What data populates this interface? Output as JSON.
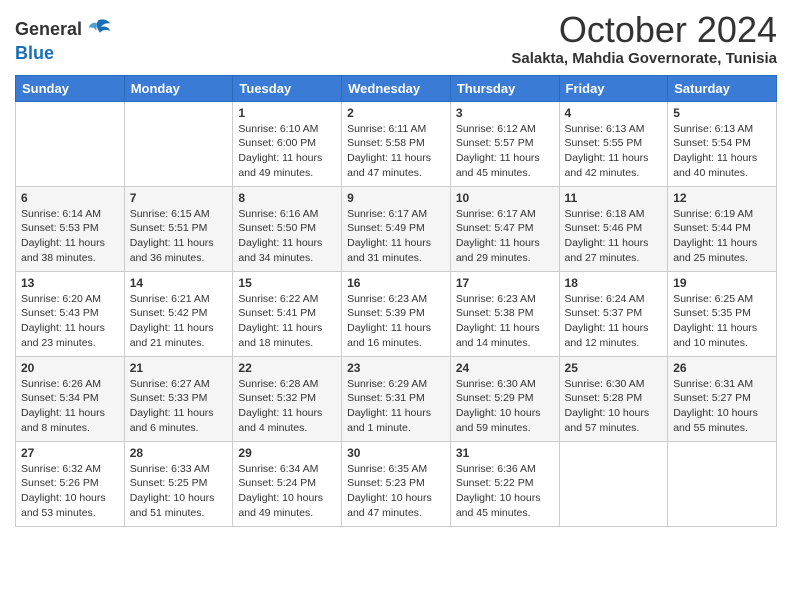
{
  "header": {
    "logo_general": "General",
    "logo_blue": "Blue",
    "month_title": "October 2024",
    "subtitle": "Salakta, Mahdia Governorate, Tunisia"
  },
  "days_of_week": [
    "Sunday",
    "Monday",
    "Tuesday",
    "Wednesday",
    "Thursday",
    "Friday",
    "Saturday"
  ],
  "weeks": [
    [
      {
        "day": "",
        "sunrise": "",
        "sunset": "",
        "daylight": ""
      },
      {
        "day": "",
        "sunrise": "",
        "sunset": "",
        "daylight": ""
      },
      {
        "day": "1",
        "sunrise": "Sunrise: 6:10 AM",
        "sunset": "Sunset: 6:00 PM",
        "daylight": "Daylight: 11 hours and 49 minutes."
      },
      {
        "day": "2",
        "sunrise": "Sunrise: 6:11 AM",
        "sunset": "Sunset: 5:58 PM",
        "daylight": "Daylight: 11 hours and 47 minutes."
      },
      {
        "day": "3",
        "sunrise": "Sunrise: 6:12 AM",
        "sunset": "Sunset: 5:57 PM",
        "daylight": "Daylight: 11 hours and 45 minutes."
      },
      {
        "day": "4",
        "sunrise": "Sunrise: 6:13 AM",
        "sunset": "Sunset: 5:55 PM",
        "daylight": "Daylight: 11 hours and 42 minutes."
      },
      {
        "day": "5",
        "sunrise": "Sunrise: 6:13 AM",
        "sunset": "Sunset: 5:54 PM",
        "daylight": "Daylight: 11 hours and 40 minutes."
      }
    ],
    [
      {
        "day": "6",
        "sunrise": "Sunrise: 6:14 AM",
        "sunset": "Sunset: 5:53 PM",
        "daylight": "Daylight: 11 hours and 38 minutes."
      },
      {
        "day": "7",
        "sunrise": "Sunrise: 6:15 AM",
        "sunset": "Sunset: 5:51 PM",
        "daylight": "Daylight: 11 hours and 36 minutes."
      },
      {
        "day": "8",
        "sunrise": "Sunrise: 6:16 AM",
        "sunset": "Sunset: 5:50 PM",
        "daylight": "Daylight: 11 hours and 34 minutes."
      },
      {
        "day": "9",
        "sunrise": "Sunrise: 6:17 AM",
        "sunset": "Sunset: 5:49 PM",
        "daylight": "Daylight: 11 hours and 31 minutes."
      },
      {
        "day": "10",
        "sunrise": "Sunrise: 6:17 AM",
        "sunset": "Sunset: 5:47 PM",
        "daylight": "Daylight: 11 hours and 29 minutes."
      },
      {
        "day": "11",
        "sunrise": "Sunrise: 6:18 AM",
        "sunset": "Sunset: 5:46 PM",
        "daylight": "Daylight: 11 hours and 27 minutes."
      },
      {
        "day": "12",
        "sunrise": "Sunrise: 6:19 AM",
        "sunset": "Sunset: 5:44 PM",
        "daylight": "Daylight: 11 hours and 25 minutes."
      }
    ],
    [
      {
        "day": "13",
        "sunrise": "Sunrise: 6:20 AM",
        "sunset": "Sunset: 5:43 PM",
        "daylight": "Daylight: 11 hours and 23 minutes."
      },
      {
        "day": "14",
        "sunrise": "Sunrise: 6:21 AM",
        "sunset": "Sunset: 5:42 PM",
        "daylight": "Daylight: 11 hours and 21 minutes."
      },
      {
        "day": "15",
        "sunrise": "Sunrise: 6:22 AM",
        "sunset": "Sunset: 5:41 PM",
        "daylight": "Daylight: 11 hours and 18 minutes."
      },
      {
        "day": "16",
        "sunrise": "Sunrise: 6:23 AM",
        "sunset": "Sunset: 5:39 PM",
        "daylight": "Daylight: 11 hours and 16 minutes."
      },
      {
        "day": "17",
        "sunrise": "Sunrise: 6:23 AM",
        "sunset": "Sunset: 5:38 PM",
        "daylight": "Daylight: 11 hours and 14 minutes."
      },
      {
        "day": "18",
        "sunrise": "Sunrise: 6:24 AM",
        "sunset": "Sunset: 5:37 PM",
        "daylight": "Daylight: 11 hours and 12 minutes."
      },
      {
        "day": "19",
        "sunrise": "Sunrise: 6:25 AM",
        "sunset": "Sunset: 5:35 PM",
        "daylight": "Daylight: 11 hours and 10 minutes."
      }
    ],
    [
      {
        "day": "20",
        "sunrise": "Sunrise: 6:26 AM",
        "sunset": "Sunset: 5:34 PM",
        "daylight": "Daylight: 11 hours and 8 minutes."
      },
      {
        "day": "21",
        "sunrise": "Sunrise: 6:27 AM",
        "sunset": "Sunset: 5:33 PM",
        "daylight": "Daylight: 11 hours and 6 minutes."
      },
      {
        "day": "22",
        "sunrise": "Sunrise: 6:28 AM",
        "sunset": "Sunset: 5:32 PM",
        "daylight": "Daylight: 11 hours and 4 minutes."
      },
      {
        "day": "23",
        "sunrise": "Sunrise: 6:29 AM",
        "sunset": "Sunset: 5:31 PM",
        "daylight": "Daylight: 11 hours and 1 minute."
      },
      {
        "day": "24",
        "sunrise": "Sunrise: 6:30 AM",
        "sunset": "Sunset: 5:29 PM",
        "daylight": "Daylight: 10 hours and 59 minutes."
      },
      {
        "day": "25",
        "sunrise": "Sunrise: 6:30 AM",
        "sunset": "Sunset: 5:28 PM",
        "daylight": "Daylight: 10 hours and 57 minutes."
      },
      {
        "day": "26",
        "sunrise": "Sunrise: 6:31 AM",
        "sunset": "Sunset: 5:27 PM",
        "daylight": "Daylight: 10 hours and 55 minutes."
      }
    ],
    [
      {
        "day": "27",
        "sunrise": "Sunrise: 6:32 AM",
        "sunset": "Sunset: 5:26 PM",
        "daylight": "Daylight: 10 hours and 53 minutes."
      },
      {
        "day": "28",
        "sunrise": "Sunrise: 6:33 AM",
        "sunset": "Sunset: 5:25 PM",
        "daylight": "Daylight: 10 hours and 51 minutes."
      },
      {
        "day": "29",
        "sunrise": "Sunrise: 6:34 AM",
        "sunset": "Sunset: 5:24 PM",
        "daylight": "Daylight: 10 hours and 49 minutes."
      },
      {
        "day": "30",
        "sunrise": "Sunrise: 6:35 AM",
        "sunset": "Sunset: 5:23 PM",
        "daylight": "Daylight: 10 hours and 47 minutes."
      },
      {
        "day": "31",
        "sunrise": "Sunrise: 6:36 AM",
        "sunset": "Sunset: 5:22 PM",
        "daylight": "Daylight: 10 hours and 45 minutes."
      },
      {
        "day": "",
        "sunrise": "",
        "sunset": "",
        "daylight": ""
      },
      {
        "day": "",
        "sunrise": "",
        "sunset": "",
        "daylight": ""
      }
    ]
  ]
}
